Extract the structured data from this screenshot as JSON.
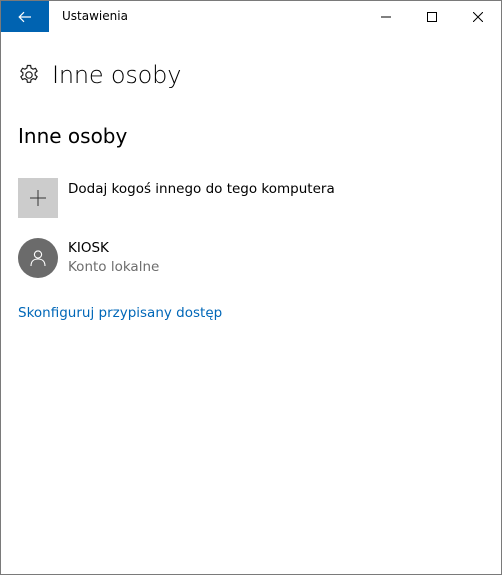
{
  "titlebar": {
    "title": "Ustawienia",
    "back_icon": "back-arrow-icon",
    "minimize_icon": "minimize-icon",
    "maximize_icon": "maximize-icon",
    "close_icon": "close-icon"
  },
  "header": {
    "icon": "gear-icon",
    "title": "Inne osoby"
  },
  "section": {
    "title": "Inne osoby"
  },
  "add_person": {
    "icon": "plus-icon",
    "label": "Dodaj kogoś innego do tego komputera"
  },
  "accounts": [
    {
      "icon": "user-icon",
      "name": "KIOSK",
      "type": "Konto lokalne"
    }
  ],
  "assigned_access": {
    "label": "Skonfiguruj przypisany dostęp"
  },
  "colors": {
    "accent": "#0063b1",
    "link": "#0067b8",
    "tile": "#cccccc",
    "avatar": "#6b6b6b",
    "secondary_text": "#6d6d6d"
  }
}
